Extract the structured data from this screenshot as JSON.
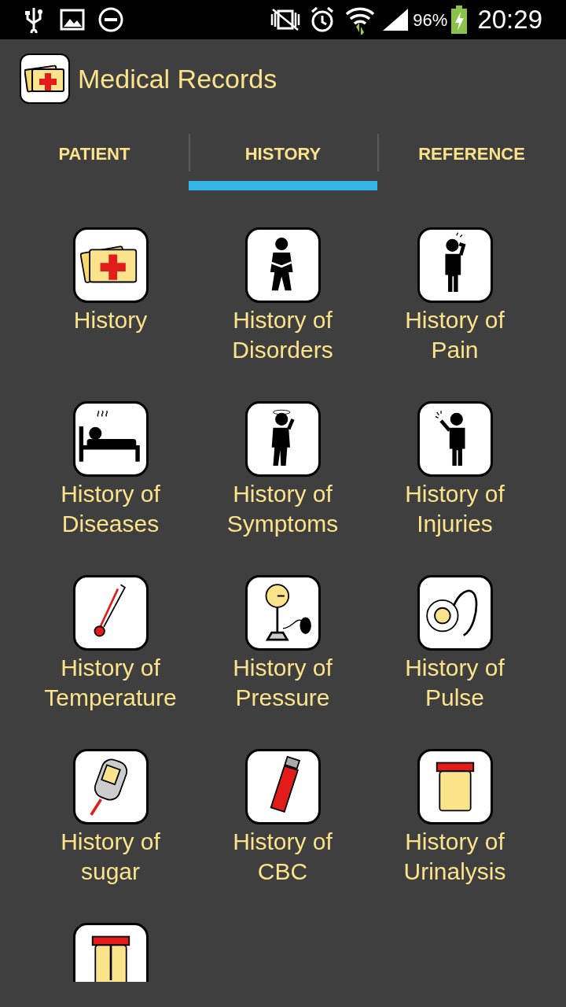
{
  "status_bar": {
    "battery_text": "96%",
    "time": "20:29"
  },
  "app_bar": {
    "title": "Medical Records"
  },
  "tabs": [
    {
      "label": "PATIENT",
      "selected": false
    },
    {
      "label": "HISTORY",
      "selected": true
    },
    {
      "label": "REFERENCE",
      "selected": false
    }
  ],
  "items": [
    {
      "label": "History"
    },
    {
      "label": "History of Disorders"
    },
    {
      "label": "History of Pain"
    },
    {
      "label": "History of Diseases"
    },
    {
      "label": "History of Symptoms"
    },
    {
      "label": "History of Injuries"
    },
    {
      "label": "History of Temperature"
    },
    {
      "label": "History of Pressure"
    },
    {
      "label": "History of Pulse"
    },
    {
      "label": "History of sugar"
    },
    {
      "label": "History of CBC"
    },
    {
      "label": "History of Urinalysis"
    },
    {
      "kind": "partial"
    }
  ]
}
